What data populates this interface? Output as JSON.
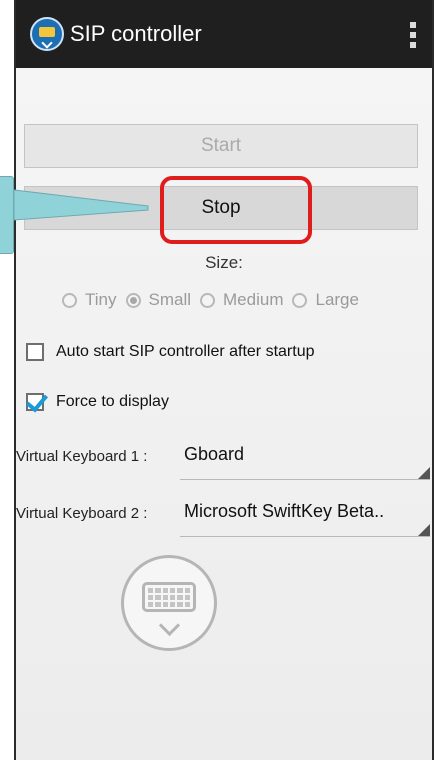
{
  "appbar": {
    "title": "SIP controller",
    "app_icon": "keyboard-app-icon",
    "menu_icon": "more-vert-icon"
  },
  "buttons": {
    "start_label": "Start",
    "start_enabled": false,
    "stop_label": "Stop"
  },
  "size": {
    "label": "Size:",
    "options": [
      "Tiny",
      "Small",
      "Medium",
      "Large"
    ],
    "selected": "Small"
  },
  "options": {
    "auto_start_label": "Auto start SIP controller after startup",
    "auto_start_checked": false,
    "force_display_label": "Force to display",
    "force_display_checked": true
  },
  "keyboards": {
    "kb1_label": "Virtual Keyboard 1 :",
    "kb1_value": "Gboard",
    "kb2_label": "Virtual Keyboard 2 :",
    "kb2_value": "Microsoft SwiftKey Beta.."
  },
  "floating_icon": "keyboard-toggle-icon",
  "annotation": {
    "highlight_color": "#e01d1d",
    "callout_color": "#8fd3d8"
  }
}
